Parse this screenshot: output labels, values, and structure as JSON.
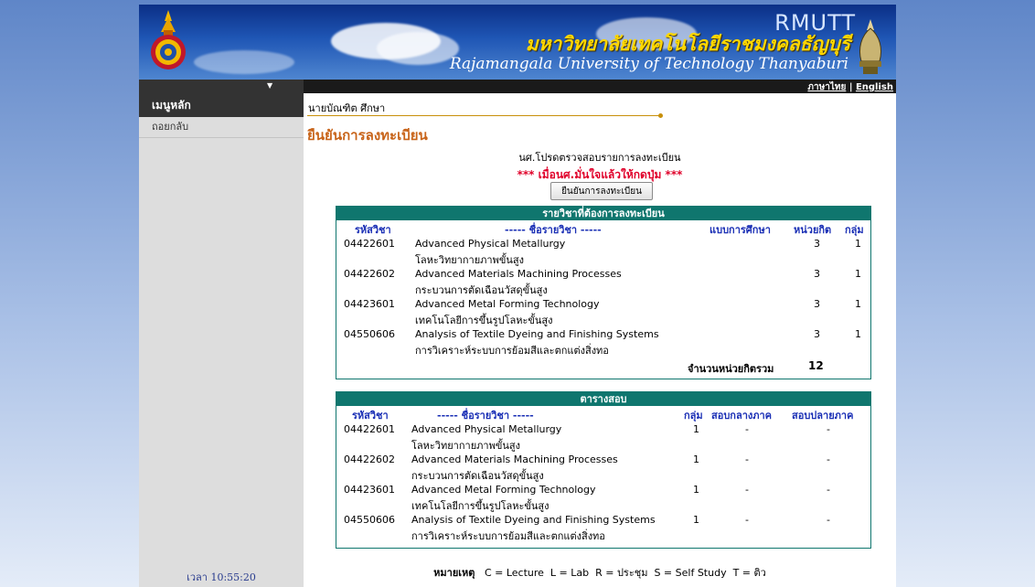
{
  "banner": {
    "abbr": "RMUTT",
    "name_th": "มหาวิทยาลัยเทคโนโลยีราชมงคลธัญบุรี",
    "name_en": "Rajamangala University of Technology Thanyaburi"
  },
  "language": {
    "thai": "ภาษาไทย",
    "separator": "|",
    "english": "English"
  },
  "sidebar": {
    "heading": "เมนูหลัก",
    "items": [
      {
        "label": "ถอยกลับ"
      }
    ],
    "clock": "เวลา 10:55:20"
  },
  "main": {
    "user_name": "นายบัณฑิต ศึกษา",
    "title": "ยืนยันการลงทะเบียน",
    "instruction": "นศ.โปรดตรวจสอบรายการลงทะเบียน",
    "warning": "*** เมื่อนศ.มั่นใจแล้วให้กดปุ่ม ***",
    "confirm_button": "ยืนยันการลงทะเบียน"
  },
  "colors": {
    "accent": "#c8641a",
    "table_header": "#0f766e",
    "warning": "#e0002a",
    "column_header": "#1a2fb5"
  },
  "registration": {
    "title": "รายวิชาที่ต้องการลงทะเบียน",
    "headers": {
      "code": "รหัสวิชา",
      "name": "----- ชื่อรายวิชา -----",
      "mode": "แบบการศึกษา",
      "credits": "หน่วยกิต",
      "group": "กลุ่ม"
    },
    "rows": [
      {
        "code": "04422601",
        "name_en": "Advanced Physical Metallurgy",
        "name_th": "โลหะวิทยากายภาพขั้นสูง",
        "credits": "3",
        "group": "1"
      },
      {
        "code": "04422602",
        "name_en": "Advanced Materials Machining Processes",
        "name_th": "กระบวนการตัดเฉือนวัสดุขั้นสูง",
        "credits": "3",
        "group": "1"
      },
      {
        "code": "04423601",
        "name_en": "Advanced Metal Forming Technology",
        "name_th": "เทคโนโลยีการขึ้นรูปโลหะขั้นสูง",
        "credits": "3",
        "group": "1"
      },
      {
        "code": "04550606",
        "name_en": "Analysis of Textile Dyeing and Finishing Systems",
        "name_th": "การวิเคราะห์ระบบการย้อมสีและตกแต่งสิ่งทอ",
        "credits": "3",
        "group": "1"
      }
    ],
    "total_label": "จำนวนหน่วยกิตรวม",
    "total_value": "12"
  },
  "exam": {
    "title": "ตารางสอบ",
    "headers": {
      "code": "รหัสวิชา",
      "name": "----- ชื่อรายวิชา -----",
      "group": "กลุ่ม",
      "midterm": "สอบกลางภาค",
      "final": "สอบปลายภาค"
    },
    "rows": [
      {
        "code": "04422601",
        "name_en": "Advanced Physical Metallurgy",
        "name_th": "โลหะวิทยากายภาพขั้นสูง",
        "group": "1",
        "midterm": "-",
        "final": "-"
      },
      {
        "code": "04422602",
        "name_en": "Advanced Materials Machining Processes",
        "name_th": "กระบวนการตัดเฉือนวัสดุขั้นสูง",
        "group": "1",
        "midterm": "-",
        "final": "-"
      },
      {
        "code": "04423601",
        "name_en": "Advanced Metal Forming Technology",
        "name_th": "เทคโนโลยีการขึ้นรูปโลหะขั้นสูง",
        "group": "1",
        "midterm": "-",
        "final": "-"
      },
      {
        "code": "04550606",
        "name_en": "Analysis of Textile Dyeing and Finishing Systems",
        "name_th": "การวิเคราะห์ระบบการย้อมสีและตกแต่งสิ่งทอ",
        "group": "1",
        "midterm": "-",
        "final": "-"
      }
    ]
  },
  "note": {
    "label": "หมายเหตุ",
    "text": "C = Lecture  L = Lab  R = ประชุม  S = Self Study  T = ติว"
  }
}
